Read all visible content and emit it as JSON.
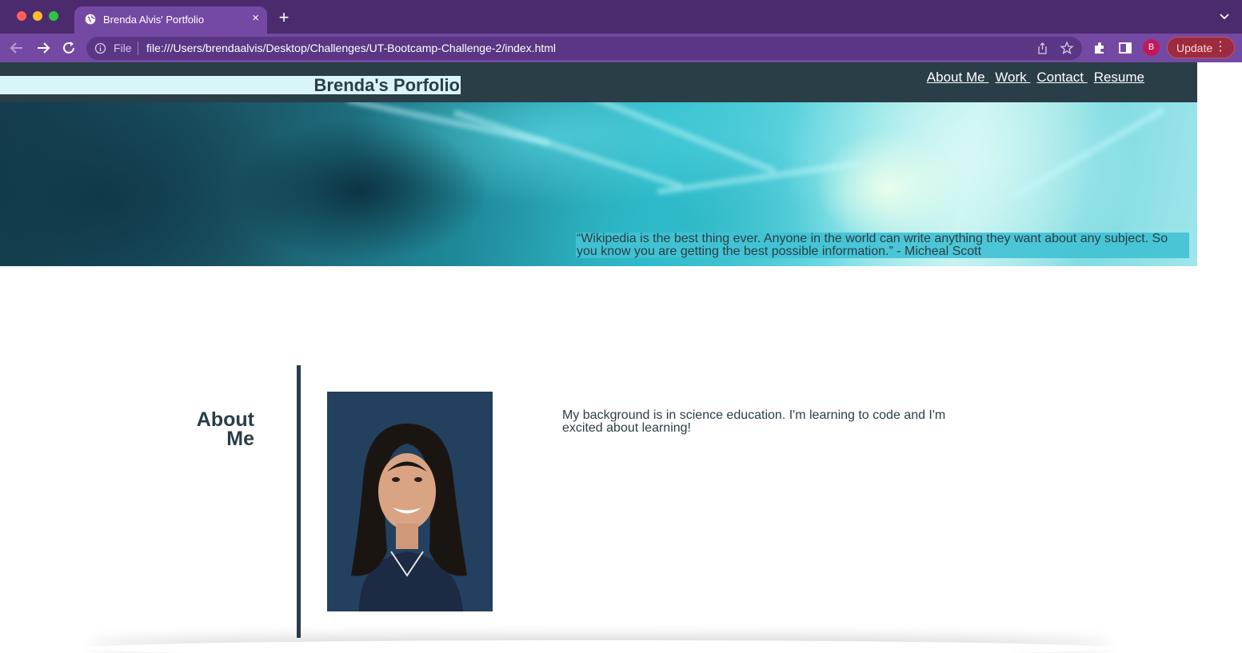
{
  "browser": {
    "tab_title": "Brenda Alvis' Portfolio",
    "tab_close": "×",
    "new_tab": "+",
    "url_scheme_label": "File",
    "url": "file:///Users/brendaalvis/Desktop/Challenges/UT-Bootcamp-Challenge-2/index.html",
    "profile_initial": "B",
    "update_label": "Update",
    "menu_dots": "⋮",
    "colors": {
      "tabbar": "#4b2b6e",
      "toolbar": "#7449a3",
      "update": "#9c2b3f"
    }
  },
  "site": {
    "brand": "Brenda's Porfolio",
    "nav": [
      {
        "label": "About Me "
      },
      {
        "label": "Work "
      },
      {
        "label": "Contact "
      },
      {
        "label": "Resume"
      }
    ],
    "quote": "“Wikipedia is the best thing ever. Anyone in the world can write anything they want about any subject. So you know you are getting the best possible information.” - Micheal Scott",
    "about": {
      "title_line1": "About",
      "title_line2": "Me",
      "text": "My background is in science education. I'm learning to code and I'm excited about learning!"
    },
    "colors": {
      "header": "#2a3e47",
      "brand_bg": "#d8f6fa",
      "quote_bg": "#42c2d4",
      "text": "#2a3e47"
    }
  }
}
